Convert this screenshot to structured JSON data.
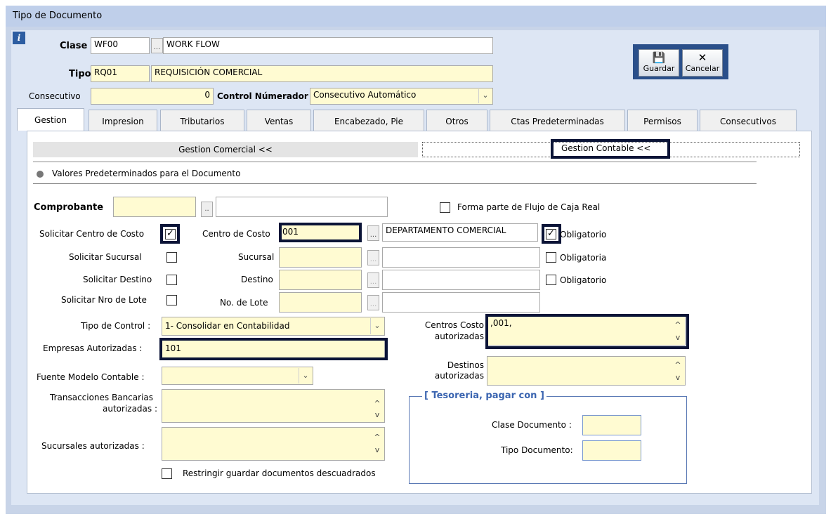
{
  "window": {
    "title": "Tipo de Documento"
  },
  "header": {
    "info_icon_glyph": "i",
    "clase_label": "Clase",
    "clase_code": "WF00",
    "clase_desc": "WORK FLOW",
    "tipo_label": "Tipo",
    "tipo_code": "RQ01",
    "tipo_desc": "REQUISICIÓN COMERCIAL",
    "consecutivo_label": "Consecutivo",
    "consecutivo_value": "0",
    "control_label": "Control Númerador :",
    "control_value": "Consecutivo Automático",
    "lookup_glyph": "...",
    "dd_glyph": "⌵"
  },
  "toolbar": {
    "guardar_label": "Guardar",
    "guardar_icon": "💾",
    "cancelar_label": "Cancelar",
    "cancelar_icon": "✕"
  },
  "tabs": [
    "Gestion",
    "Impresion",
    "Tributarios",
    "Ventas",
    "Encabezado, Pie",
    "Otros",
    "Ctas Predeterminadas",
    "Permisos",
    "Consecutivos"
  ],
  "subtabs": {
    "comercial": "Gestion Comercial <<",
    "contable": "Gestion Contable <<"
  },
  "section": {
    "title": "Valores Predeterminados para el Documento"
  },
  "form": {
    "comprobante_label": "Comprobante",
    "comprobante_value": "",
    "comprobante_desc": "",
    "flujo_caja_label": "Forma parte de Flujo de Caja  Real",
    "solicitar_cc_label": "Solicitar Centro de Costo",
    "solicitar_cc_checked": true,
    "centro_costo_label": "Centro de Costo",
    "centro_costo_value": "001",
    "centro_costo_desc": "DEPARTAMENTO COMERCIAL",
    "obligatorio_cc_label": "Obligatorio",
    "obligatorio_cc_checked": true,
    "solicitar_sucursal_label": "Solicitar Sucursal",
    "sucursal_label": "Sucursal",
    "obligatoria_suc_label": "Obligatoria",
    "solicitar_destino_label": "Solicitar Destino",
    "destino_label": "Destino",
    "obligatorio_dest_label": "Obligatorio",
    "solicitar_lote_label": "Solicitar Nro de  Lote",
    "lote_label": "No. de Lote",
    "tipo_control_label": "Tipo de Control :",
    "tipo_control_value": "1- Consolidar en Contabilidad",
    "empresas_label": "Empresas Autorizadas :",
    "empresas_value": "101",
    "fuente_label": "Fuente Modelo Contable :",
    "fuente_value": "",
    "transacciones_label_1": "Transacciones Bancarias",
    "transacciones_label_2": "autorizadas :",
    "sucursales_aut_label": "Sucursales autorizadas :",
    "restringir_label": "Restringir guardar documentos descuadrados",
    "centros_aut_label_1": "Centros Costo",
    "centros_aut_label_2": "autorizadas",
    "centros_aut_value": ",001,",
    "destinos_aut_label_1": "Destinos",
    "destinos_aut_label_2": "autorizadas",
    "scroll_up": "^",
    "scroll_down": "v",
    "check_glyph": "✓"
  },
  "tesoreria": {
    "title": "[ Tesoreria, pagar con ]",
    "clase_label": "Clase Documento :",
    "tipo_label": "Tipo Documento:"
  }
}
